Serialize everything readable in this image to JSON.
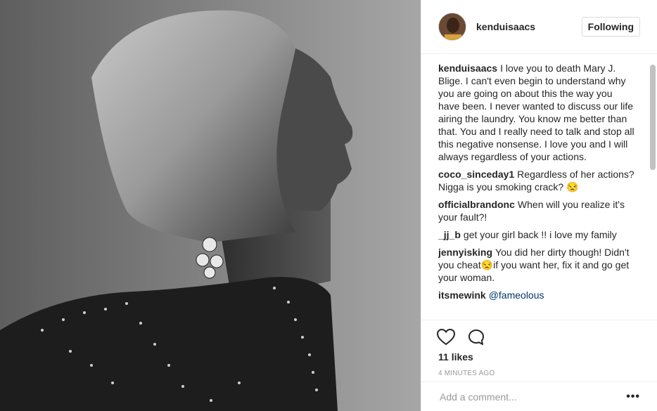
{
  "post": {
    "username": "kenduisaacs",
    "follow_label": "Following",
    "likes": "11 likes",
    "time": "4 MINUTES AGO",
    "comment_placeholder": "Add a comment...",
    "more_label": "•••"
  },
  "comments": [
    {
      "user": "kenduisaacs",
      "text": "I love you to death Mary J. Blige. I can't even begin to understand why you are going on about this the way you have been. I never wanted to discuss our life airing the laundry. You know me better than that. You and I really need to talk and stop all this negative nonsense. I love you and I will always regardless of your actions."
    },
    {
      "user": "coco_sinceday1",
      "text": "Regardless of her actions? Nigga is you smoking crack? 😒"
    },
    {
      "user": "officialbrandonc",
      "text": "When will you realize it's your fault?!"
    },
    {
      "user": "_jj_b",
      "text": "get your girl back !! i love my family"
    },
    {
      "user": "jennyisking",
      "text": "You did her dirty though! Didn't you cheat😒if you want her, fix it and go get your woman."
    },
    {
      "user": "itsmewink",
      "text": "",
      "mention": "@fameolous"
    }
  ],
  "icons": {
    "like": "heart-icon",
    "comment": "comment-bubble-icon",
    "more": "more-options-icon"
  }
}
